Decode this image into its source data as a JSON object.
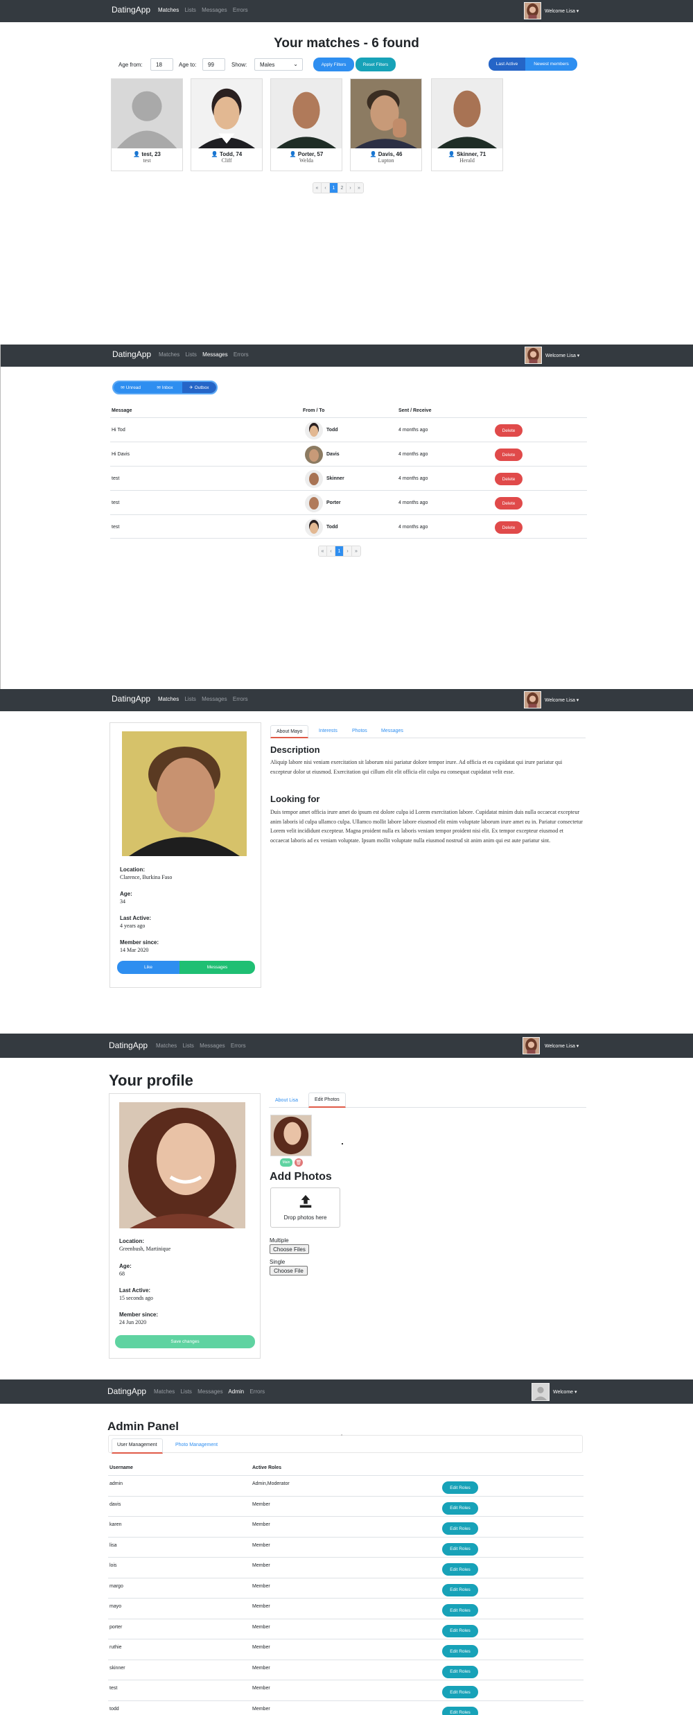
{
  "nav": {
    "brand": "DatingApp",
    "matches": "Matches",
    "lists": "Lists",
    "messages": "Messages",
    "errors": "Errors",
    "admin": "Admin",
    "welcome": "Welcome Lisa ▾",
    "welcome_admin": "Welcome ▾"
  },
  "matches": {
    "title": "Your matches - 6 found",
    "age_from_label": "Age from:",
    "age_from_value": "18",
    "age_to_label": "Age to:",
    "age_to_value": "99",
    "show_label": "Show:",
    "show_value": "Males",
    "apply_label": "Apply Filters",
    "reset_label": "Reset Filters",
    "last_active_label": "Last Active",
    "newest_label": "Newest members",
    "cards": [
      {
        "name": "test, 23",
        "city": "test"
      },
      {
        "name": "Todd, 74",
        "city": "Cliff"
      },
      {
        "name": "Porter, 57",
        "city": "Welda"
      },
      {
        "name": "Davis, 46",
        "city": "Lupton"
      },
      {
        "name": "Skinner, 71",
        "city": "Herald"
      }
    ],
    "pager": [
      "«",
      "‹",
      "1",
      "2",
      "›",
      "»"
    ]
  },
  "messages": {
    "unread": "Unread",
    "inbox": "Inbox",
    "outbox": "Outbox",
    "col_message": "Message",
    "col_from": "From / To",
    "col_sent": "Sent / Receive",
    "delete_label": "Delete",
    "rows": [
      {
        "message": "Hi Tod",
        "name": "Todd",
        "sent": "4 months ago"
      },
      {
        "message": "Hi Davis",
        "name": "Davis",
        "sent": "4 months ago"
      },
      {
        "message": "test",
        "name": "Skinner",
        "sent": "4 months ago"
      },
      {
        "message": "test",
        "name": "Porter",
        "sent": "4 months ago"
      },
      {
        "message": "test",
        "name": "Todd",
        "sent": "4 months ago"
      }
    ],
    "pager": [
      "«",
      "‹",
      "1",
      "›",
      "»"
    ]
  },
  "member": {
    "location_label": "Location:",
    "location": "Clarence, Burkina Faso",
    "age_label": "Age:",
    "age": "34",
    "last_active_label": "Last Active:",
    "last_active": "4 years ago",
    "member_since_label": "Member since:",
    "member_since": "14 Mar 2020",
    "like_label": "Like",
    "messages_label": "Messages",
    "tabs": [
      "About Mayo",
      "Interests",
      "Photos",
      "Messages"
    ],
    "description_heading": "Description",
    "description": "Aliquip labore nisi veniam exercitation sit laborum nisi pariatur dolore tempor irure. Ad officia et eu cupidatat qui irure pariatur qui excepteur dolor ut eiusmod. Exercitation qui cillum elit elit officia elit culpa eu consequat cupidatat velit esse.",
    "looking_heading": "Looking for",
    "looking": "Duis tempor amet officia irure amet do ipsum est dolore culpa id Lorem exercitation labore. Cupidatat minim duis nulla occaecat excepteur anim laboris id culpa ullamco culpa. Ullamco mollit labore labore eiusmod elit enim voluptate laborum irure amet eu in. Pariatur consectetur Lorem velit incididunt excepteur. Magna proident nulla ex laboris veniam tempor proident nisi elit. Ex tempor excepteur eiusmod et occaecat laboris ad ex veniam voluptate. Ipsum mollit voluptate nulla eiusmod nostrud sit anim anim qui est aute pariatur sint."
  },
  "profile": {
    "title": "Your profile",
    "location_label": "Location:",
    "location": "Greenbush, Martinique",
    "age_label": "Age:",
    "age": "68",
    "last_active_label": "Last Active:",
    "last_active": "15 seconds ago",
    "member_since_label": "Member since:",
    "member_since": "24 Jun 2020",
    "save_label": "Save changes",
    "tab_about": "About Lisa",
    "tab_photos": "Edit Photos",
    "main_label": "Main",
    "add_photos": "Add Photos",
    "drop_label": "Drop photos here",
    "multiple_label": "Multiple",
    "single_label": "Single",
    "choose_files": "Choose Files",
    "choose_file": "Choose File"
  },
  "admin": {
    "title": "Admin Panel",
    "tab_users": "User Management",
    "tab_photos": "Photo Management",
    "col_username": "Username",
    "col_roles": "Active Roles",
    "edit_label": "Edit Roles",
    "rows": [
      {
        "username": "admin",
        "roles": "Admin,Moderator"
      },
      {
        "username": "davis",
        "roles": "Member"
      },
      {
        "username": "karen",
        "roles": "Member"
      },
      {
        "username": "lisa",
        "roles": "Member"
      },
      {
        "username": "lois",
        "roles": "Member"
      },
      {
        "username": "margo",
        "roles": "Member"
      },
      {
        "username": "mayo",
        "roles": "Member"
      },
      {
        "username": "porter",
        "roles": "Member"
      },
      {
        "username": "ruthie",
        "roles": "Member"
      },
      {
        "username": "skinner",
        "roles": "Member"
      },
      {
        "username": "test",
        "roles": "Member"
      },
      {
        "username": "todd",
        "roles": "Member"
      }
    ]
  },
  "colors": {
    "navbar": "#343a40",
    "primary": "#2e8ef0",
    "info": "#17a2b8",
    "danger": "#e04a4a",
    "success": "#1fbf73",
    "accent": "#e05a47"
  }
}
